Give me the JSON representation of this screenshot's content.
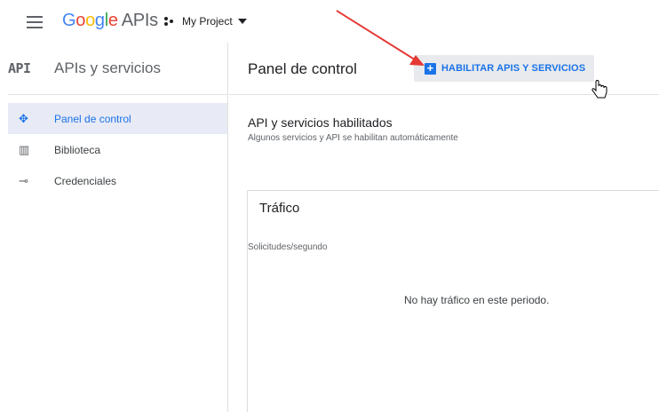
{
  "topbar": {
    "logo_parts": [
      "G",
      "o",
      "o",
      "g",
      "l",
      "e"
    ],
    "logo_suffix": "APIs",
    "project_name": "My Project"
  },
  "sidebar": {
    "badge": "API",
    "title": "APIs y servicios",
    "items": [
      {
        "label": "Panel de control",
        "icon": "dashboard-icon",
        "active": true
      },
      {
        "label": "Biblioteca",
        "icon": "library-icon",
        "active": false
      },
      {
        "label": "Credenciales",
        "icon": "key-icon",
        "active": false
      }
    ]
  },
  "main": {
    "page_title": "Panel de control",
    "enable_button": "HABILITAR APIS Y SERVICIOS",
    "section_title": "API y servicios habilitados",
    "section_subtitle": "Algunos servicios y API se habilitan automáticamente",
    "traffic": {
      "title": "Tráfico",
      "unit_label": "Solicitudes/segundo",
      "empty_message": "No hay tráfico en este periodo."
    }
  },
  "colors": {
    "accent": "#1a73e8",
    "annotation_arrow": "#e53935",
    "active_nav_bg": "#e8eaf6"
  }
}
